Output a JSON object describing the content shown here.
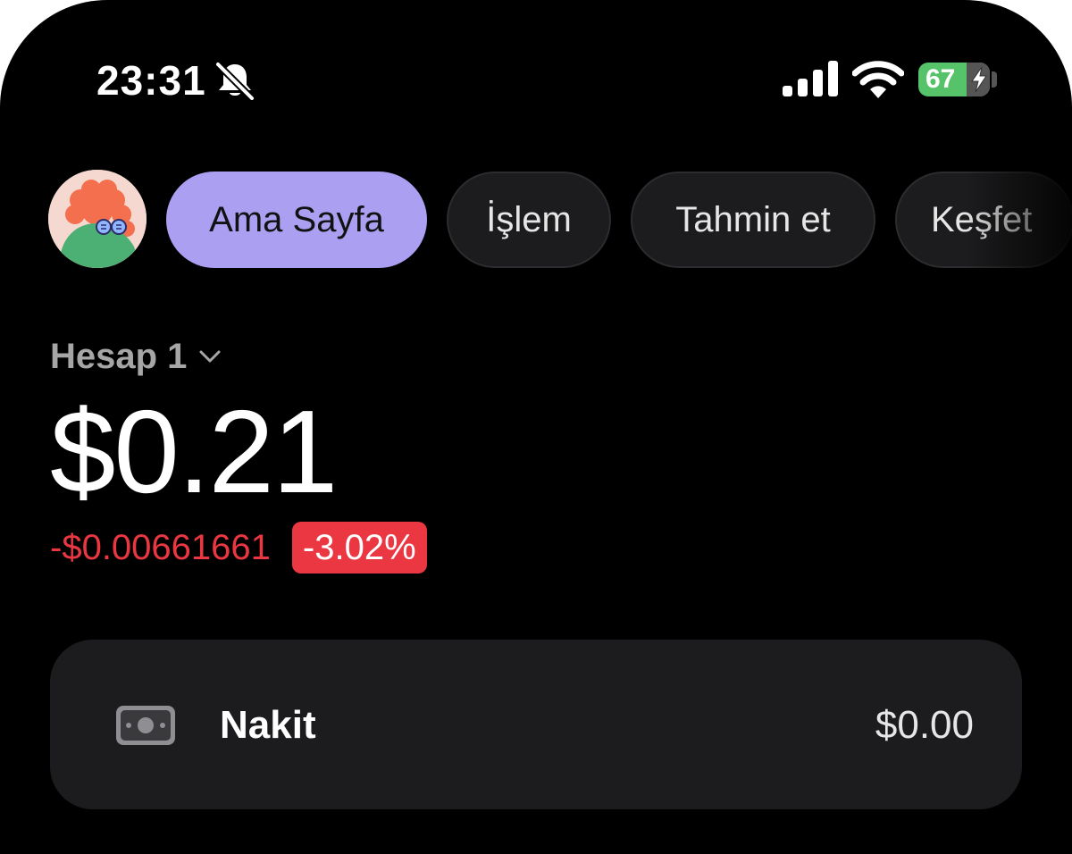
{
  "status_bar": {
    "time": "23:31",
    "battery_percent": "67",
    "icons": [
      "bell-slash-icon",
      "signal-icon",
      "wifi-icon",
      "battery-charging-icon"
    ]
  },
  "nav": {
    "tabs": [
      {
        "label": "Ama Sayfa",
        "active": true
      },
      {
        "label": "İşlem",
        "active": false
      },
      {
        "label": "Tahmin et",
        "active": false
      },
      {
        "label": "Keşfet",
        "active": false
      }
    ]
  },
  "account": {
    "name": "Hesap 1",
    "balance": "$0.21",
    "change_amount": "-$0.00661661",
    "change_percent": "-3.02%"
  },
  "cash_card": {
    "label": "Nakit",
    "value": "$0.00",
    "icon": "banknote-icon"
  },
  "colors": {
    "background": "#000000",
    "accent": "#ab9ff2",
    "negative": "#eb3742",
    "card": "#1c1c1e",
    "battery": "#56c36a"
  }
}
